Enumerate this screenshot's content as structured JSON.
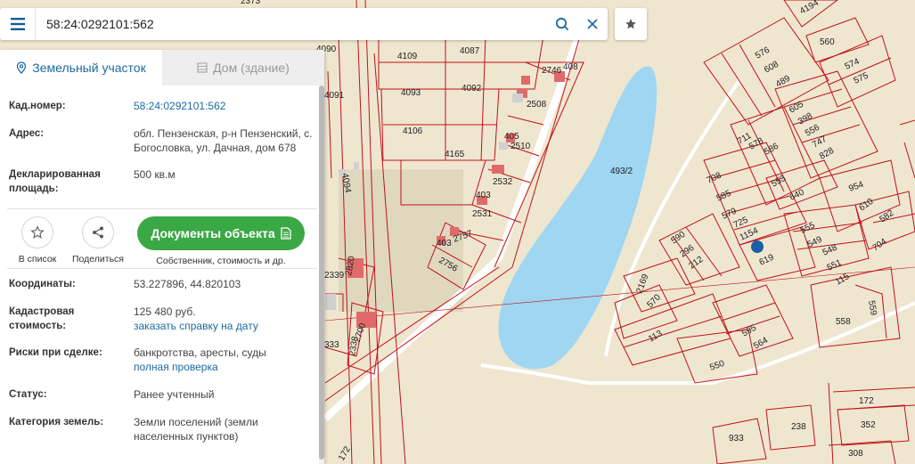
{
  "search": {
    "query": "58:24:0292101:562"
  },
  "tabs": [
    {
      "label": "Земельный участок"
    },
    {
      "label": "Дом (здание)"
    }
  ],
  "info": {
    "cad_label": "Кад.номер:",
    "cad_value": "58:24:0292101:562",
    "addr_label": "Адрес:",
    "addr_value": "обл. Пензенская, р-н Пензенский, с. Богословка, ул. Дачная, дом 678",
    "area_label": "Декларированная площадь:",
    "area_value": "500 кв.м"
  },
  "actions": {
    "favorite_label": "В список",
    "share_label": "Поделиться",
    "docs_label": "Документы объекта",
    "docs_sub": "Собственник, стоимость и др."
  },
  "details": {
    "coord_label": "Координаты:",
    "coord_value": "53.227896, 44.820103",
    "cost_label": "Кадастровая стоимость:",
    "cost_value": "125 480 руб.",
    "cost_link": "заказать справку на дату",
    "risk_label": "Риски при сделке:",
    "risk_value": "банкротства, аресты, суды",
    "risk_link": "полная проверка",
    "status_label": "Статус:",
    "status_value": "Ранее учтенный",
    "category_label": "Категория земель:",
    "category_value": "Земли поселений (земли населенных пунктов)"
  },
  "map": {
    "parcel_color": "#c0121a",
    "water_color": "#9fd6f2",
    "marker_color": "#1a5fa8",
    "labels": [
      "2373",
      "4090",
      "4109",
      "4087",
      "4091",
      "4093",
      "4092",
      "2746",
      "408",
      "2508",
      "4106",
      "2510",
      "4165",
      "405",
      "2532",
      "4094",
      "493/2",
      "403",
      "2531",
      "2757",
      "2756",
      "403",
      "2339",
      "2820",
      "2700",
      "2338",
      "333",
      "4194",
      "560",
      "576",
      "608",
      "489",
      "574",
      "575",
      "605",
      "398",
      "556",
      "747",
      "828",
      "711",
      "578",
      "586",
      "553",
      "708",
      "585",
      "640",
      "954",
      "579",
      "1154",
      "610",
      "725",
      "555",
      "582",
      "590",
      "549",
      "296",
      "548",
      "212",
      "619",
      "551",
      "704",
      "2169",
      "570",
      "115",
      "113",
      "595",
      "564",
      "558",
      "559",
      "550",
      "172",
      "238",
      "352",
      "933",
      "308",
      "172"
    ]
  }
}
